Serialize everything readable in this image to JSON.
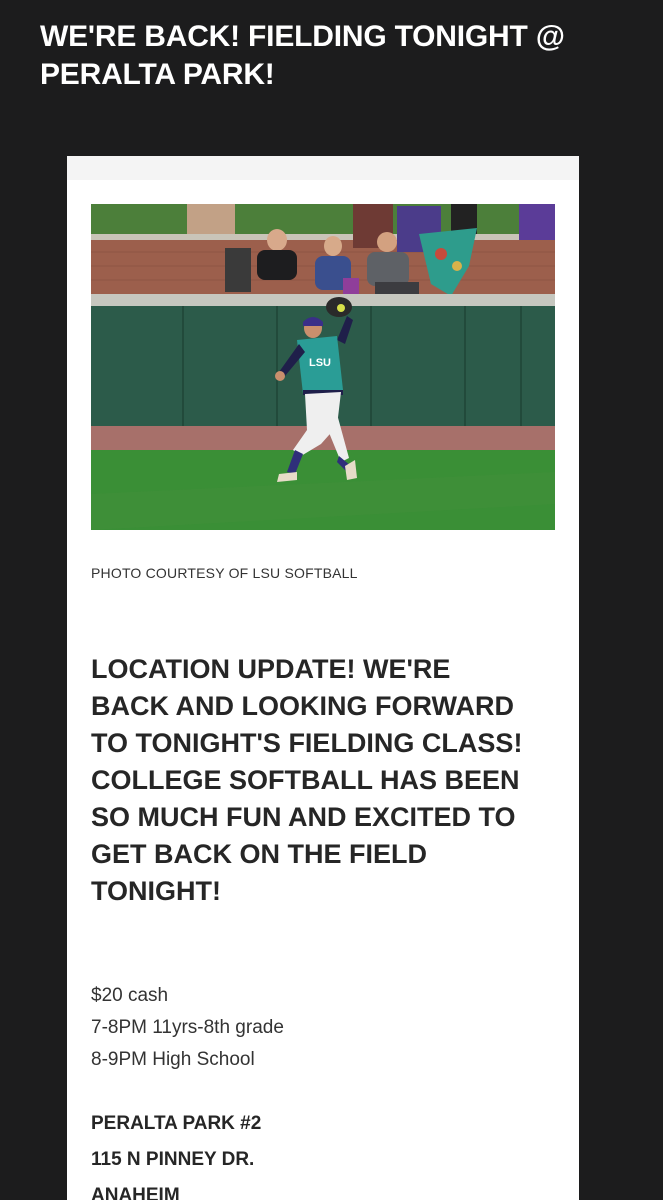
{
  "post": {
    "title": "WE'RE BACK! FIELDING TONIGHT @ PERALTA PARK!"
  },
  "card": {
    "photo_caption": "PHOTO COURTESY OF LSU SOFTBALL",
    "jersey_text": "LSU",
    "headline": "LOCATION UPDATE! WE'RE BACK AND LOOKING FORWARD TO TONIGHT'S FIELDING CLASS! COLLEGE SOFTBALL HAS BEEN SO MUCH FUN AND EXCITED TO GET BACK ON THE FIELD TONIGHT!",
    "details": [
      "$20 cash",
      "7-8PM 11yrs-8th grade",
      "8-9PM High School"
    ],
    "address": [
      "PERALTA PARK #2",
      "115 N PINNEY DR.",
      "ANAHEIM"
    ]
  },
  "colors": {
    "page_background": "#1c1c1d",
    "card_background": "#ffffff",
    "title_text": "#ffffff",
    "headline_text": "#262626",
    "jersey_teal": "#2a9d96",
    "outfield_wall": "#2c5b4a"
  }
}
